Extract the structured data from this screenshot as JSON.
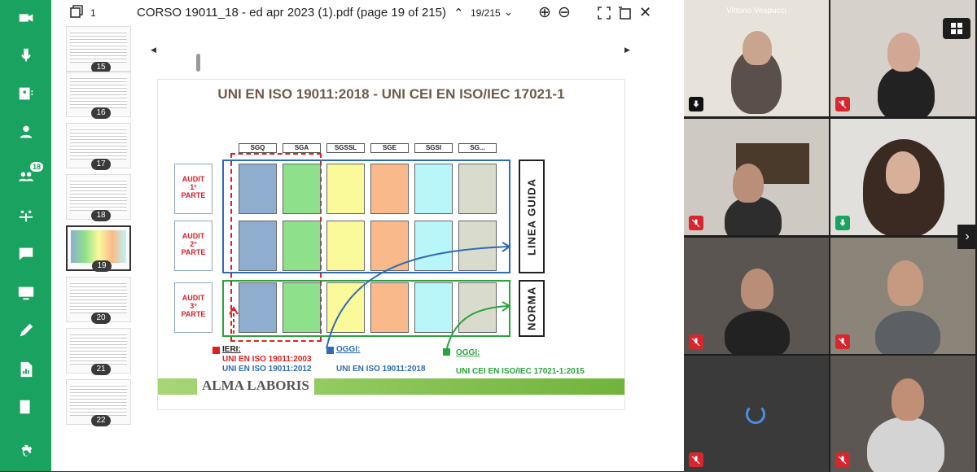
{
  "rail": {
    "participants_count": "18"
  },
  "viewer": {
    "window_count": "1",
    "title": "CORSO 19011_18 - ed apr 2023 (1).pdf (page 19 of 215)",
    "page_indicator": "19/215",
    "thumbnails": [
      "15",
      "16",
      "17",
      "18",
      "19",
      "20",
      "21",
      "22"
    ]
  },
  "slide": {
    "title": "UNI EN ISO 19011:2018 - UNI CEI EN ISO/IEC 17021-1",
    "headers": [
      "SGQ",
      "SGA",
      "SGSSL",
      "SGE",
      "SGSI",
      "SG..."
    ],
    "audit_rows": [
      "AUDIT\n1°\nPARTE",
      "AUDIT\n2°\nPARTE",
      "AUDIT\n3°\nPARTE"
    ],
    "side_labels": [
      "LINEA GUIDA",
      "NORMA"
    ],
    "legend": {
      "ieri_label": "IERI:",
      "ieri_std1": "UNI EN ISO 19011:2003",
      "ieri_std2": "UNI EN ISO 19011:2012",
      "oggi1_label": "OGGI:",
      "oggi1_std": "UNI EN ISO 19011:2018",
      "oggi2_label": "OGGI:",
      "oggi2_std": "UNI CEI EN ISO/IEC 17021-1:2015"
    },
    "logo": "ALMA LABORIS"
  },
  "participants": [
    {
      "name": "Vittorio Vespucci",
      "mic": "plain"
    },
    {
      "name": "",
      "mic": "muted"
    },
    {
      "name": "",
      "mic": "muted"
    },
    {
      "name": "",
      "mic": "on"
    },
    {
      "name": "",
      "mic": "muted"
    },
    {
      "name": "",
      "mic": "muted"
    },
    {
      "name": "",
      "mic": "muted"
    },
    {
      "name": "",
      "mic": "muted"
    }
  ],
  "colors": {
    "accent": "#1aa260",
    "muted": "#d7272e",
    "cells": [
      "#8eadcf",
      "#8fe08a",
      "#fafa9a",
      "#f9b98a",
      "#b9f6f9",
      "#d9dccd"
    ]
  }
}
